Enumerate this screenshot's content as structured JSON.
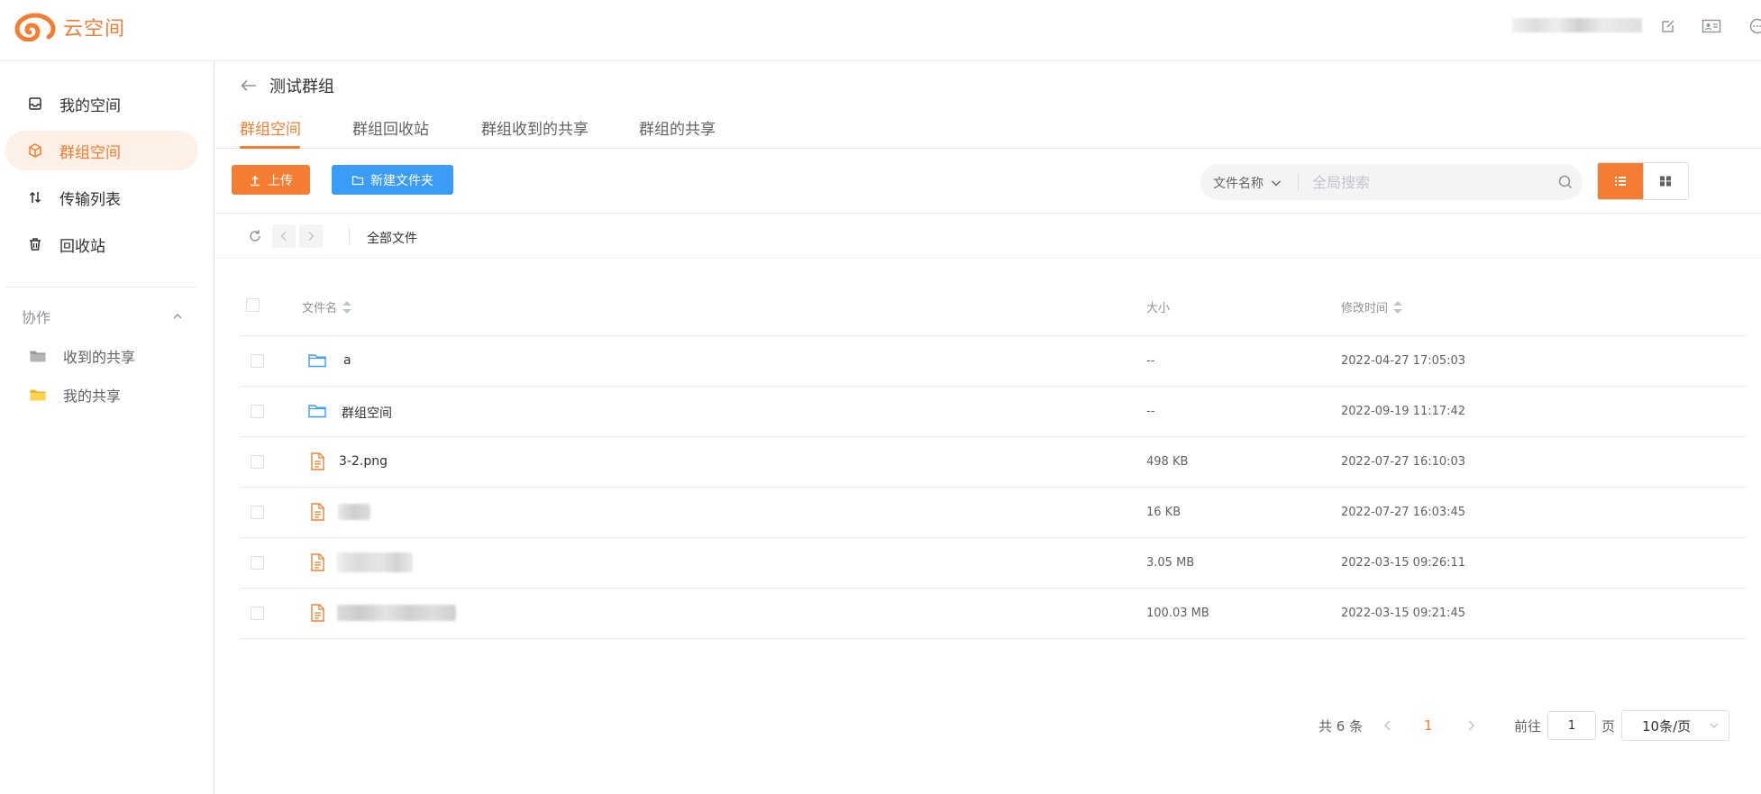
{
  "app": {
    "logo_text": "云空间",
    "brand_color": "#f57d31",
    "link_color": "#3a9cf5"
  },
  "sidebar": {
    "items": [
      {
        "label": "我的空间",
        "icon": "inbox-icon"
      },
      {
        "label": "群组空间",
        "icon": "cube-icon",
        "active": true
      },
      {
        "label": "传输列表",
        "icon": "transfer-icon"
      },
      {
        "label": "回收站",
        "icon": "trash-icon"
      }
    ],
    "group_label": "协作",
    "sub_items": [
      {
        "label": "收到的共享",
        "icon": "folder-gray-icon"
      },
      {
        "label": "我的共享",
        "icon": "folder-yellow-icon"
      }
    ]
  },
  "header": {
    "title": "测试群组",
    "tabs": [
      "群组空间",
      "群组回收站",
      "群组收到的共享",
      "群组的共享"
    ],
    "active_tab": 0
  },
  "toolbar": {
    "upload_label": "上传",
    "new_folder_label": "新建文件夹",
    "search_type": "文件名称",
    "search_placeholder": "全局搜索",
    "view_mode": "list"
  },
  "pathbar": {
    "current": "全部文件"
  },
  "table": {
    "columns": [
      "文件名",
      "大小",
      "修改时间"
    ],
    "rows": [
      {
        "name": "a",
        "type": "folder",
        "size": "--",
        "modified": "2022-04-27 17:05:03"
      },
      {
        "name": "群组空间",
        "type": "folder",
        "size": "--",
        "modified": "2022-09-19 11:17:42"
      },
      {
        "name": "3-2.png",
        "type": "file",
        "size": "498 KB",
        "modified": "2022-07-27 16:10:03"
      },
      {
        "name": "",
        "type": "file",
        "size": "16 KB",
        "modified": "2022-07-27 16:03:45"
      },
      {
        "name": "",
        "type": "file",
        "size": "3.05 MB",
        "modified": "2022-03-15 09:26:11"
      },
      {
        "name": "",
        "type": "file",
        "size": "100.03 MB",
        "modified": "2022-03-15 09:21:45"
      }
    ]
  },
  "pagination": {
    "total_text": "共 6 条",
    "current_page": "1",
    "goto_label": "前往",
    "goto_value": "1",
    "page_suffix": "页",
    "page_size": "10条/页"
  }
}
